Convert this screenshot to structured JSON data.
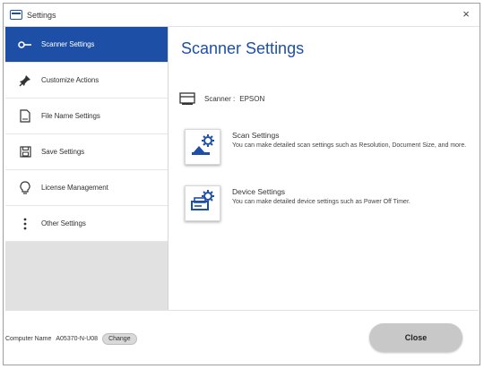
{
  "window": {
    "title": "Settings",
    "close_glyph": "×"
  },
  "sidebar": {
    "items": [
      {
        "label": "Scanner Settings",
        "icon": "scanner-connection-icon",
        "active": true
      },
      {
        "label": "Customize Actions",
        "icon": "push-pin-icon",
        "active": false
      },
      {
        "label": "File Name Settings",
        "icon": "document-icon",
        "active": false
      },
      {
        "label": "Save Settings",
        "icon": "save-disk-icon",
        "active": false
      },
      {
        "label": "License Management",
        "icon": "lightbulb-icon",
        "active": false
      },
      {
        "label": "Other Settings",
        "icon": "more-vertical-icon",
        "active": false
      }
    ]
  },
  "main": {
    "title": "Scanner Settings",
    "scanner_label": "Scanner :",
    "scanner_value": "EPSON",
    "options": [
      {
        "title": "Scan Settings",
        "description": "You can make detailed scan settings such as Resolution, Document Size, and more.",
        "icon": "scan-settings-icon"
      },
      {
        "title": "Device Settings",
        "description": "You can make detailed device settings such as Power Off Timer.",
        "icon": "device-settings-icon"
      }
    ]
  },
  "footer": {
    "computer_name_label": "Computer Name",
    "computer_name_value": "A05370-N-U08",
    "change_label": "Change",
    "close_label": "Close"
  },
  "colors": {
    "accent": "#1e4fa7",
    "sidebar_background": "#e1e1e1",
    "close_button": "#c8c8c8"
  }
}
